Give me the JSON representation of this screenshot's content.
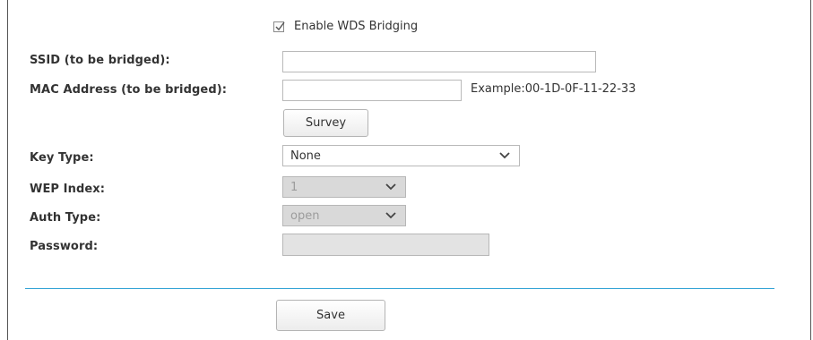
{
  "wds": {
    "enable_label": "Enable WDS Bridging",
    "enabled": true
  },
  "fields": {
    "ssid_label": "SSID (to be bridged):",
    "ssid_value": "",
    "mac_label": "MAC Address (to be bridged):",
    "mac_value": "",
    "mac_example": "Example:00-1D-0F-11-22-33",
    "survey_label": "Survey",
    "key_type_label": "Key Type:",
    "key_type_value": "None",
    "wep_index_label": "WEP Index:",
    "wep_index_value": "1",
    "auth_type_label": "Auth Type:",
    "auth_type_value": "open",
    "password_label": "Password:",
    "password_value": ""
  },
  "actions": {
    "save_label": "Save"
  },
  "colors": {
    "divider": "#33a3d6",
    "disabled_bg": "#d9d9d9"
  }
}
